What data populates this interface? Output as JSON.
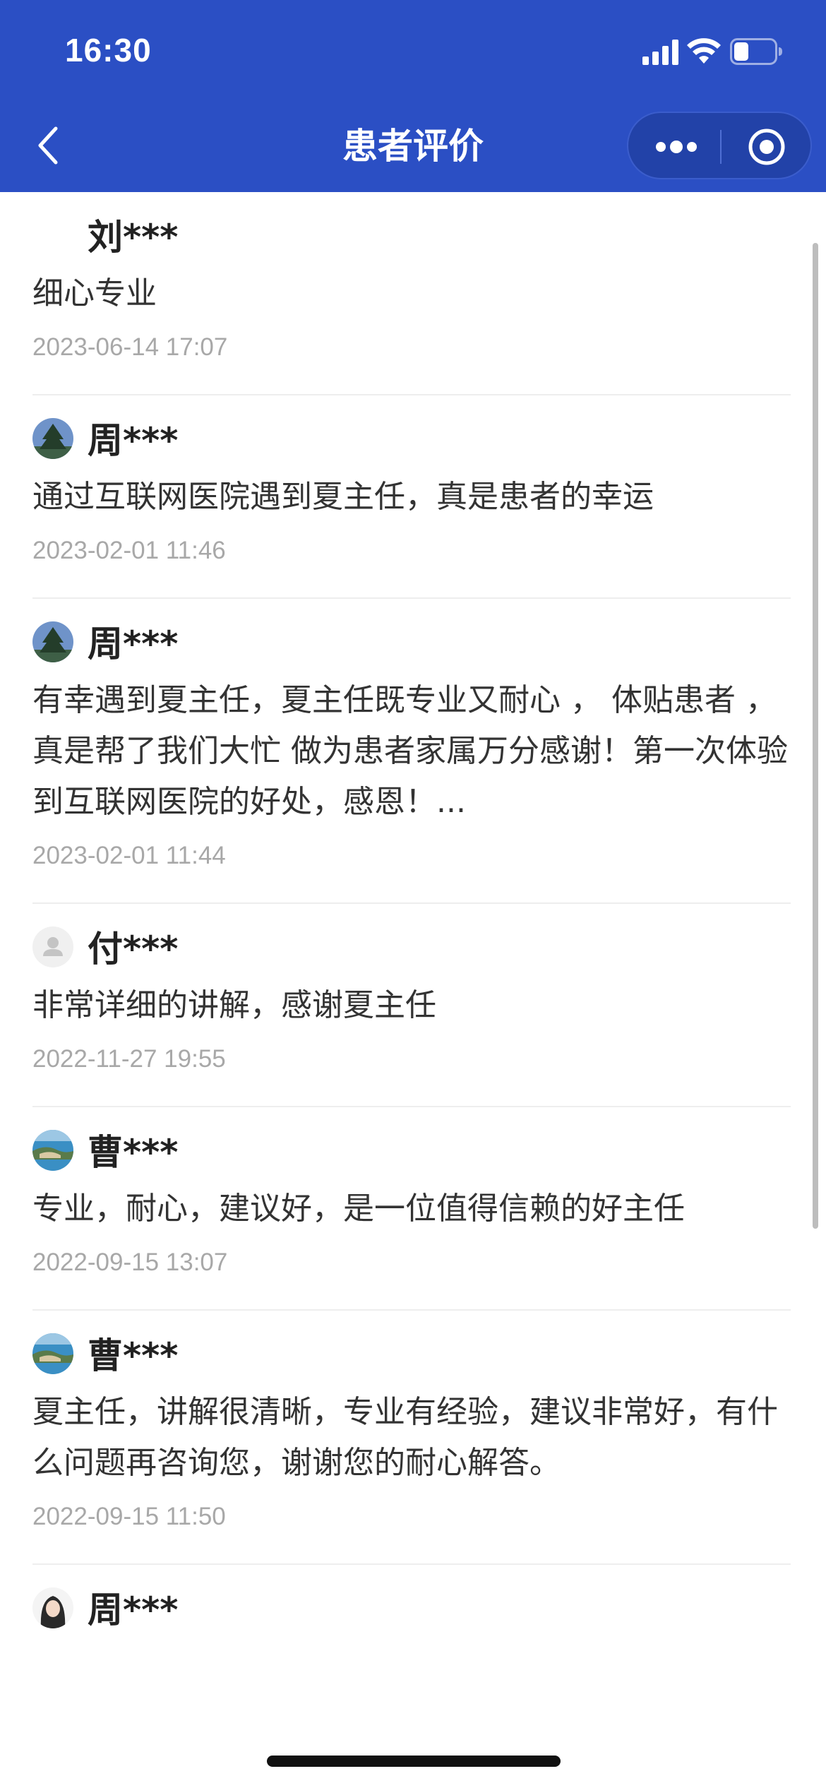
{
  "status_bar": {
    "time": "16:30",
    "icons": [
      "cellular-signal-icon",
      "wifi-icon",
      "battery-icon"
    ]
  },
  "nav": {
    "back_icon": "chevron-left-icon",
    "title": "患者评价",
    "more_icon": "more-dots-icon",
    "close_icon": "target-circle-icon"
  },
  "colors": {
    "header_bg": "#2b4fc4",
    "text_primary": "#222222",
    "text_secondary": "#a8a8a8",
    "divider": "#eeeeee"
  },
  "reviews": [
    {
      "name": "刘***",
      "avatar": "none",
      "content": "细心专业",
      "time": "2023-06-14 17:07"
    },
    {
      "name": "周***",
      "avatar": "tree-photo-avatar",
      "content": "通过互联网医院遇到夏主任，真是患者的幸运",
      "time": "2023-02-01 11:46"
    },
    {
      "name": "周***",
      "avatar": "tree-photo-avatar",
      "content": "有幸遇到夏主任，夏主任既专业又耐心 ， 体贴患者 ，真是帮了我们大忙 做为患者家属万分感谢！第一次体验到互联网医院的好处，感恩！...",
      "time": "2023-02-01 11:44"
    },
    {
      "name": "付***",
      "avatar": "default-user-avatar",
      "content": "非常详细的讲解，感谢夏主任",
      "time": "2022-11-27 19:55"
    },
    {
      "name": "曹***",
      "avatar": "sea-photo-avatar",
      "content": "专业，耐心，建议好，是一位值得信赖的好主任",
      "time": "2022-09-15 13:07"
    },
    {
      "name": "曹***",
      "avatar": "sea-photo-avatar",
      "content": "夏主任，讲解很清晰，专业有经验，建议非常好，有什么问题再咨询您，谢谢您的耐心解答。",
      "time": "2022-09-15 11:50"
    },
    {
      "name": "周***",
      "avatar": "girl-photo-avatar",
      "content": "",
      "time": ""
    }
  ]
}
